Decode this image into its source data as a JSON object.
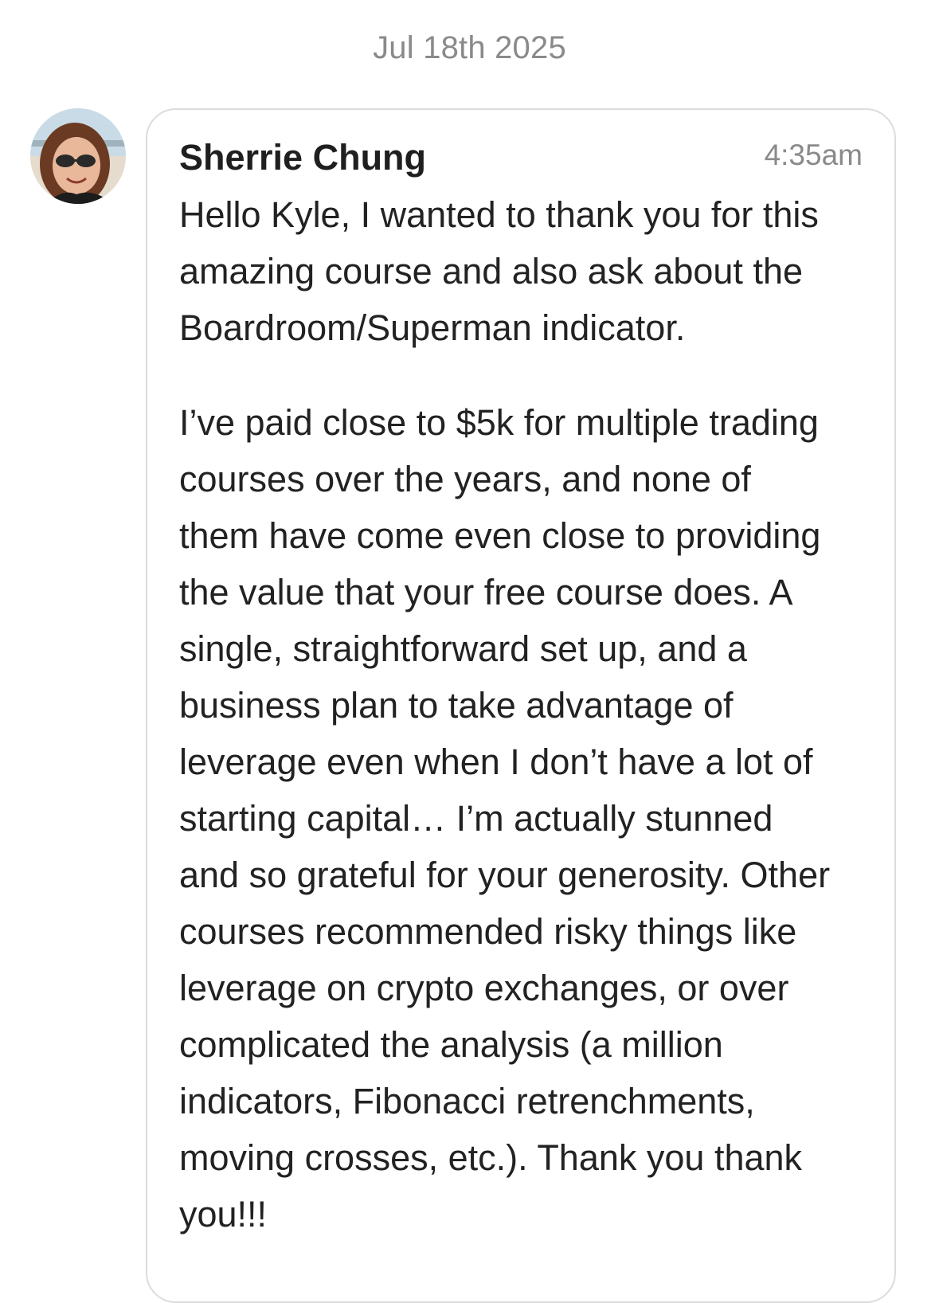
{
  "date_separator": "Jul 18th 2025",
  "message": {
    "sender": "Sherrie Chung",
    "time": "4:35am",
    "paragraphs": [
      [
        "Hello Kyle, I wanted to thank you for this",
        "amazing course and also ask about the",
        "Boardroom/Superman indicator."
      ],
      [
        "I’ve paid close to $5k for multiple trading",
        "courses over the years, and none of",
        "them have come even close to providing",
        "the value that your free course does. A",
        "single, straightforward set up, and a",
        "business plan to take advantage of",
        "leverage even when I don’t have a lot of",
        "starting capital… I’m actually stunned",
        "and so grateful for your generosity. Other",
        "courses recommended risky things like",
        "leverage on crypto exchanges, or over",
        "complicated the analysis (a million",
        "indicators, Fibonacci retrenchments,",
        "moving crosses, etc.). Thank you thank",
        "you!!!"
      ]
    ]
  }
}
